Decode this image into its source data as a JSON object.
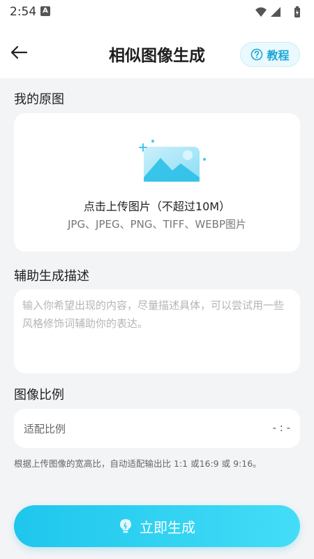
{
  "status_bar": {
    "time": "2:54",
    "notification_glyph": "A"
  },
  "header": {
    "back_icon": "arrow-left-icon",
    "title": "相似图像生成",
    "tutorial_label": "教程"
  },
  "original_section": {
    "title": "我的原图",
    "upload_hint": "点击上传图片（不超过10M）",
    "formats": "JPG、JPEG、PNG、TIFF、WEBP图片"
  },
  "description_section": {
    "title": "辅助生成描述",
    "value": "",
    "placeholder": "输入你希望出现的内容，尽量描述具体，可以尝试用一些风格修饰词辅助你的表达。"
  },
  "ratio_section": {
    "title": "图像比例",
    "label": "适配比例",
    "value": "- : -",
    "hint": "根据上传图像的宽高比，自动适配输出比 1:1 或16:9 或 9:16。"
  },
  "generate_button": {
    "label": "立即生成"
  },
  "colors": {
    "accent": "#1fc6ec",
    "accent_light": "#43ddf7",
    "background": "#f3f4f6"
  }
}
